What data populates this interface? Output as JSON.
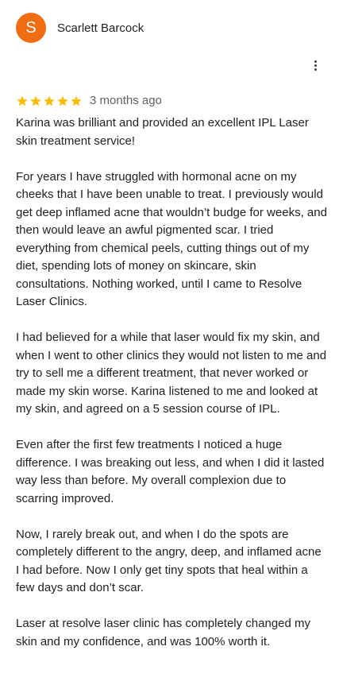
{
  "reviewer": {
    "initial": "S",
    "name": "Scarlett Barcock",
    "avatar_color": "#f06d12"
  },
  "review": {
    "rating": 5,
    "star_color": "#fbbc04",
    "time": "3 months ago",
    "paragraphs": [
      "Karina was brilliant and provided an excellent IPL Laser skin treatment service!",
      "For years I have struggled with hormonal acne on my cheeks that I have been unable to treat. I previously would get deep inflamed acne that wouldn’t budge for weeks, and then would leave an awful pigmented scar. I tried everything from chemical peels, cutting things out of my diet, spending lots of money on skincare, skin consultations. Nothing worked, until I came to Resolve Laser Clinics.",
      "I had believed for a while that laser would fix my skin, and when I went to other clinics they would not listen to me and try to sell me a different treatment, that never worked or made my skin worse. Karina listened to me and looked at my skin, and agreed on a 5 session course of IPL.",
      "Even after the first few treatments I noticed a huge difference. I was breaking out less, and when I did it lasted way less than before. My overall complexion due to scarring improved.",
      "Now, I rarely break out, and when I do the spots are completely different to the angry, deep, and inflamed acne I had before. Now I only get tiny spots that heal within a few days and don’t scar.",
      "Laser at resolve laser clinic has completely changed my skin and my confidence, and was 100% worth it."
    ]
  },
  "icons": {
    "more": "more-vert-icon",
    "star": "star-icon"
  }
}
